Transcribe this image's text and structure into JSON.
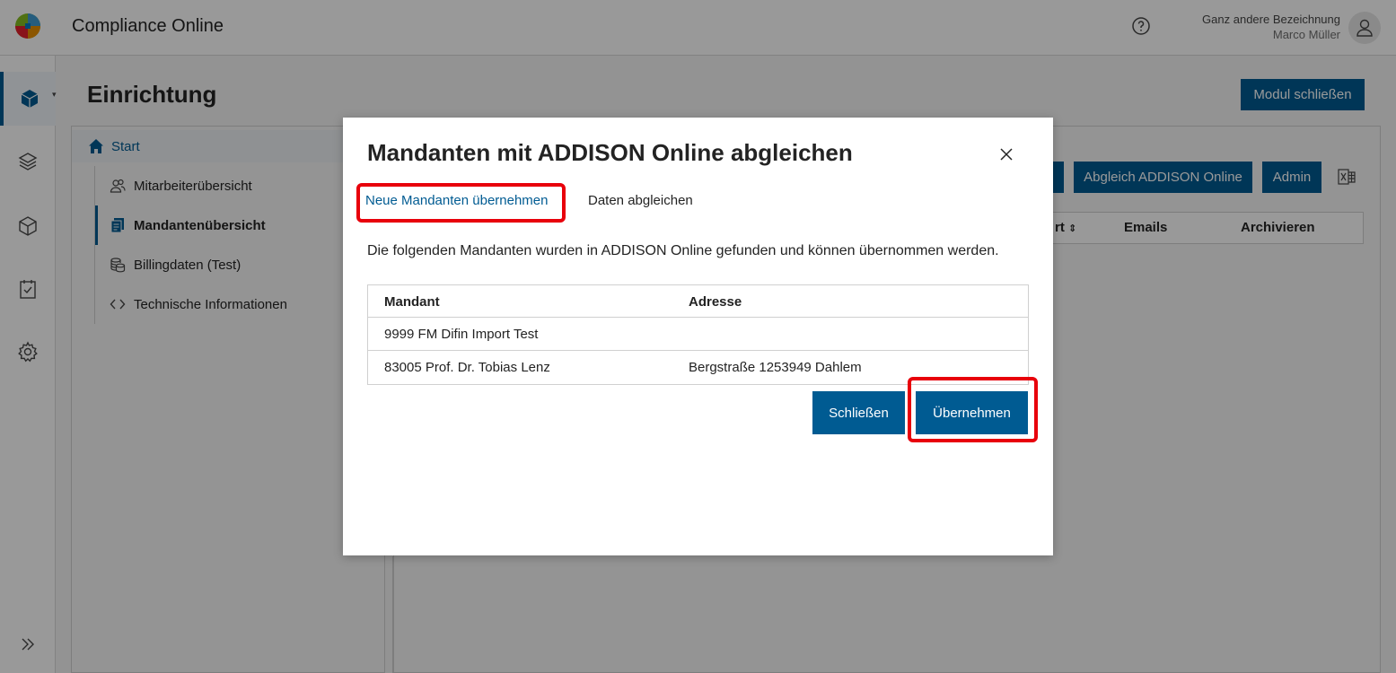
{
  "app": {
    "title": "Compliance Online"
  },
  "user": {
    "org": "Ganz andere Bezeichnung",
    "name": "Marco Müller"
  },
  "page": {
    "title": "Einrichtung",
    "close_module_label": "Modul schließen"
  },
  "sidebar": {
    "start_label": "Start",
    "items": [
      {
        "label": "Mitarbeiterübersicht",
        "icon": "users-icon"
      },
      {
        "label": "Mandantenübersicht",
        "icon": "document-stack-icon",
        "active": true
      },
      {
        "label": "Billingdaten (Test)",
        "icon": "coins-icon"
      },
      {
        "label": "Technische Informationen",
        "icon": "code-icon"
      }
    ]
  },
  "rail": {
    "items": [
      "cube-solid-icon",
      "layers-icon",
      "cube-outline-icon",
      "clipboard-check-icon",
      "gear-icon"
    ],
    "expand_icon": "double-chevron-right-icon"
  },
  "toolbar": {
    "abgleich_label": "Abgleich ADDISON Online",
    "admin_label": "Admin",
    "excel_icon": "excel-icon"
  },
  "background_table": {
    "headers": [
      "rt",
      "Emails",
      "Archivieren"
    ]
  },
  "dialog": {
    "title": "Mandanten mit ADDISON Online abgleichen",
    "tabs": [
      "Neue Mandanten übernehmen",
      "Daten abgleichen"
    ],
    "description": "Die folgenden Mandanten wurden in ADDISON Online gefunden und können übernommen werden.",
    "table": {
      "headers": [
        "Mandant",
        "Adresse"
      ],
      "rows": [
        [
          "9999 FM Difin Import Test",
          ""
        ],
        [
          "83005 Prof. Dr. Tobias Lenz",
          "Bergstraße 1253949 Dahlem"
        ]
      ]
    },
    "close_label": "Schließen",
    "accept_label": "Übernehmen"
  },
  "colors": {
    "primary": "#005b92",
    "highlight": "#e8000b",
    "overlay": "rgba(0,0,0,0.4)"
  }
}
